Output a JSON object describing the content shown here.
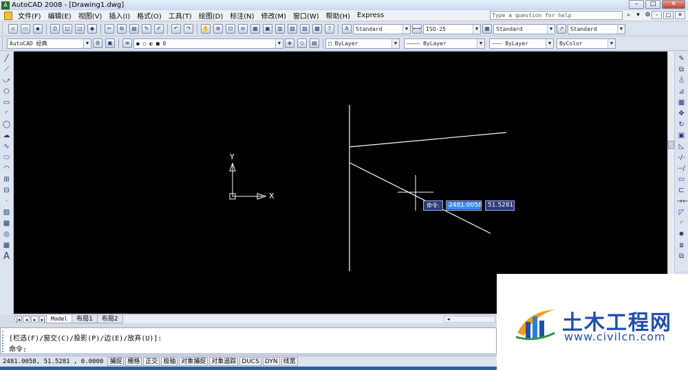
{
  "window": {
    "title": "AutoCAD 2008 - [Drawing1.dwg]",
    "app_icon": "acad-icon",
    "buttons": [
      "–",
      "□",
      "✕"
    ]
  },
  "menubar": {
    "items": [
      "文件(F)",
      "编辑(E)",
      "视图(V)",
      "插入(I)",
      "格式(O)",
      "工具(T)",
      "绘图(D)",
      "标注(N)",
      "修改(M)",
      "窗口(W)",
      "帮助(H)",
      "Express"
    ],
    "help_placeholder": "Type a question for help",
    "doc_buttons": [
      "–",
      "□",
      "✕"
    ]
  },
  "toolbar1": {
    "text_style": "Standard",
    "dim_style": "ISO-25",
    "table_style": "Standard",
    "mleader_style": "Standard"
  },
  "toolbar2": {
    "workspace": "AutoCAD 经典",
    "layer": "0",
    "color": "ByLayer",
    "linetype": "ByLayer",
    "lineweight": "ByLayer",
    "plotstyle": "ByColor"
  },
  "canvas": {
    "ucs_x_label": "X",
    "ucs_y_label": "Y",
    "dyn_prompt": "命令:",
    "dyn_x_value": "2481.0058",
    "dyn_y_value": "51.5281"
  },
  "layout_tabs": {
    "nav": [
      "|◂",
      "◂",
      "▸",
      "▸|"
    ],
    "tabs": [
      "Model",
      "布局1",
      "布局2"
    ],
    "active": "Model"
  },
  "command": {
    "line1": "[栏选(F)/窗交(C)/投影(P)/边(E)/放弃(U)]:",
    "line2": "命令:"
  },
  "statusbar": {
    "coords": "2481.0058,  51.5281  , 0.0000",
    "buttons": [
      "捕捉",
      "栅格",
      "正交",
      "极轴",
      "对象捕捉",
      "对象追踪",
      "DUCS",
      "DYN",
      "线宽"
    ]
  },
  "watermark": {
    "title": "土木工程网",
    "url": "www.civilcn.com"
  }
}
